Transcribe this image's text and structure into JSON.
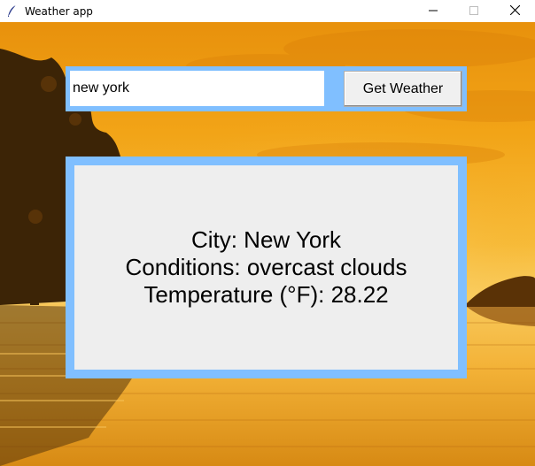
{
  "window": {
    "title": "Weather app",
    "icon": "feather-icon",
    "controls": [
      "minimize-icon",
      "maximize-icon",
      "close-icon"
    ]
  },
  "search": {
    "value": "new york",
    "button_label": "Get Weather"
  },
  "result": {
    "city_line": "City: New York",
    "conditions_line": "Conditions: overcast clouds",
    "temperature_line": "Temperature (°F): 28.22"
  },
  "colors": {
    "frame_accent": "#80bfff",
    "panel_background": "#eeeeee",
    "button_background": "#f0f0f0"
  }
}
